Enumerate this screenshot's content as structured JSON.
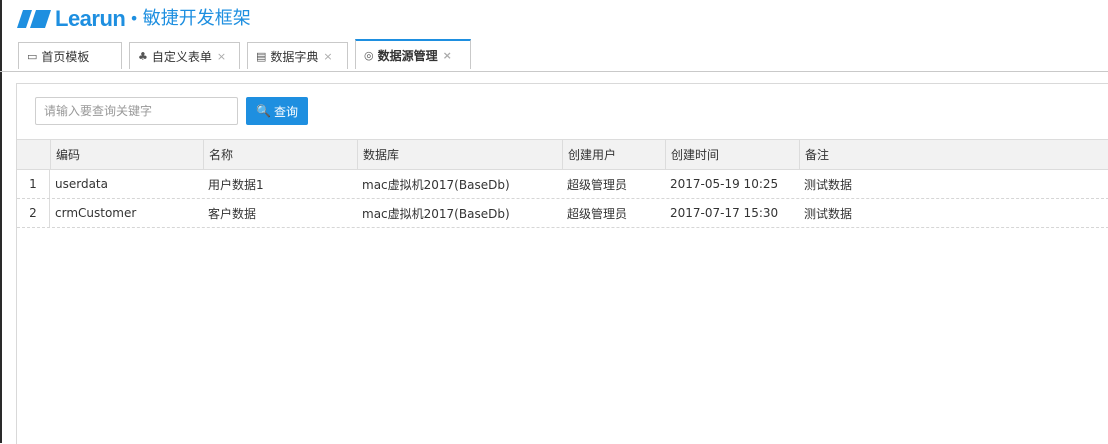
{
  "brand": {
    "name": "Learun",
    "separator": "•",
    "subtitle": "敏捷开发框架",
    "color": "#1e8fe0"
  },
  "tabs": [
    {
      "icon": "monitor-icon",
      "glyph": "▭",
      "label": "首页模板",
      "closable": false,
      "active": false
    },
    {
      "icon": "form-icon",
      "glyph": "♣",
      "label": "自定义表单",
      "closable": true,
      "active": false
    },
    {
      "icon": "book-icon",
      "glyph": "▤",
      "label": "数据字典",
      "closable": true,
      "active": false
    },
    {
      "icon": "database-icon",
      "glyph": "◎",
      "label": "数据源管理",
      "closable": true,
      "active": true
    }
  ],
  "close_glyph": "×",
  "search": {
    "placeholder": "请输入要查询关键字",
    "value": "",
    "button_label": "查询",
    "button_glyph": "🔍"
  },
  "table": {
    "columns": [
      "",
      "编码",
      "名称",
      "数据库",
      "创建用户",
      "创建时间",
      "备注"
    ],
    "rows": [
      {
        "num": "1",
        "code": "userdata",
        "name": "用户数据1",
        "db": "mac虚拟机2017(BaseDb)",
        "user": "超级管理员",
        "time": "2017-05-19 10:25",
        "note": "测试数据"
      },
      {
        "num": "2",
        "code": "crmCustomer",
        "name": "客户数据",
        "db": "mac虚拟机2017(BaseDb)",
        "user": "超级管理员",
        "time": "2017-07-17 15:30",
        "note": "测试数据"
      }
    ]
  }
}
